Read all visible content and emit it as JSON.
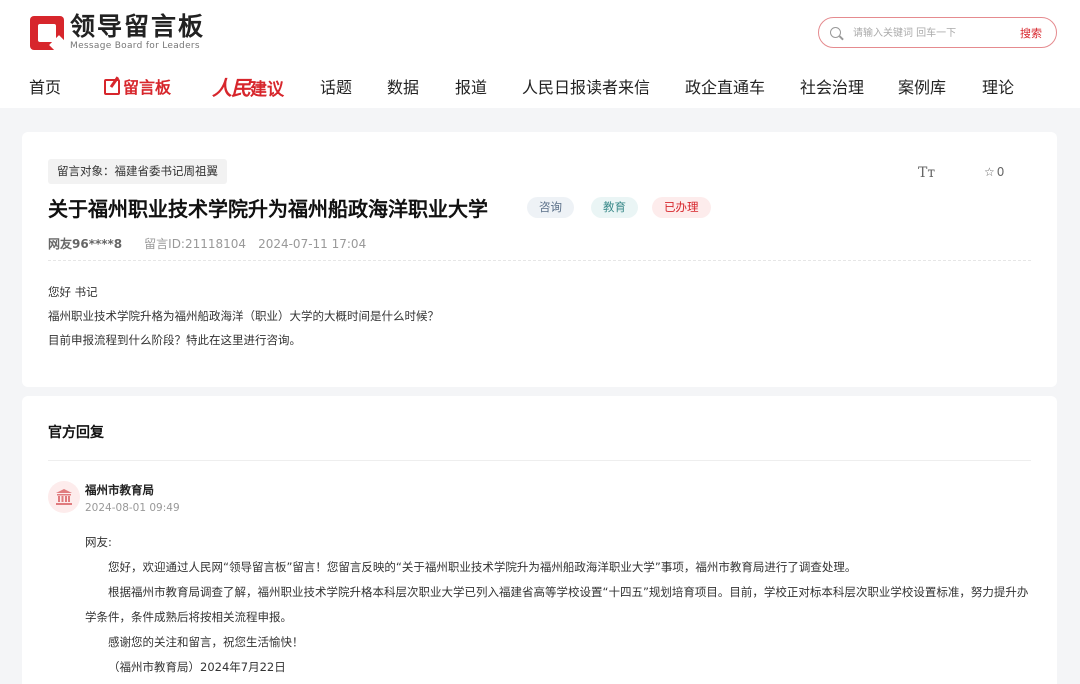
{
  "header": {
    "logo_title": "领导留言板",
    "logo_sub": "Message Board for Leaders",
    "search_placeholder": "请输入关键词 回车一下",
    "search_button": "搜索"
  },
  "nav": {
    "items": [
      "首页",
      "留言板",
      "人民建议",
      "话题",
      "数据",
      "报道",
      "人民日报读者来信",
      "政企直通车",
      "社会治理",
      "案例库",
      "理论"
    ],
    "rmjy_brush": "人民",
    "rmjy_rest": "建议"
  },
  "message": {
    "target": "留言对象：福建省委书记周祖翼",
    "font_size_label": "Tт",
    "favorites": "0",
    "title": "关于福州职业技术学院升为福州船政海洋职业大学",
    "tags": [
      "咨询",
      "教育",
      "已办理"
    ],
    "user": "网友96****8",
    "msg_id": "留言ID:21118104",
    "time": "2024-07-11 17:04",
    "body": [
      "您好 书记",
      "福州职业技术学院升格为福州船政海洋（职业）大学的大概时间是什么时候？",
      "目前申报流程到什么阶段？特此在这里进行咨询。"
    ]
  },
  "reply": {
    "heading": "官方回复",
    "department": "福州市教育局",
    "date": "2024-08-01 09:49",
    "greeting": "网友:",
    "paragraphs": [
      "您好，欢迎通过人民网“领导留言板”留言！您留言反映的“关于福州职业技术学院升为福州船政海洋职业大学”事项，福州市教育局进行了调查处理。",
      "根据福州市教育局调查了解，福州职业技术学院升格本科层次职业大学已列入福建省高等学校设置“十四五”规划培育项目。目前，学校正对标本科层次职业学校设置标准，努力提升办学条件，条件成熟后将按相关流程申报。",
      "感谢您的关注和留言，祝您生活愉快！",
      "（福州市教育局）2024年7月22日"
    ]
  },
  "colors": {
    "brand_red": "#d7262c",
    "page_bg": "#f4f5f7"
  }
}
